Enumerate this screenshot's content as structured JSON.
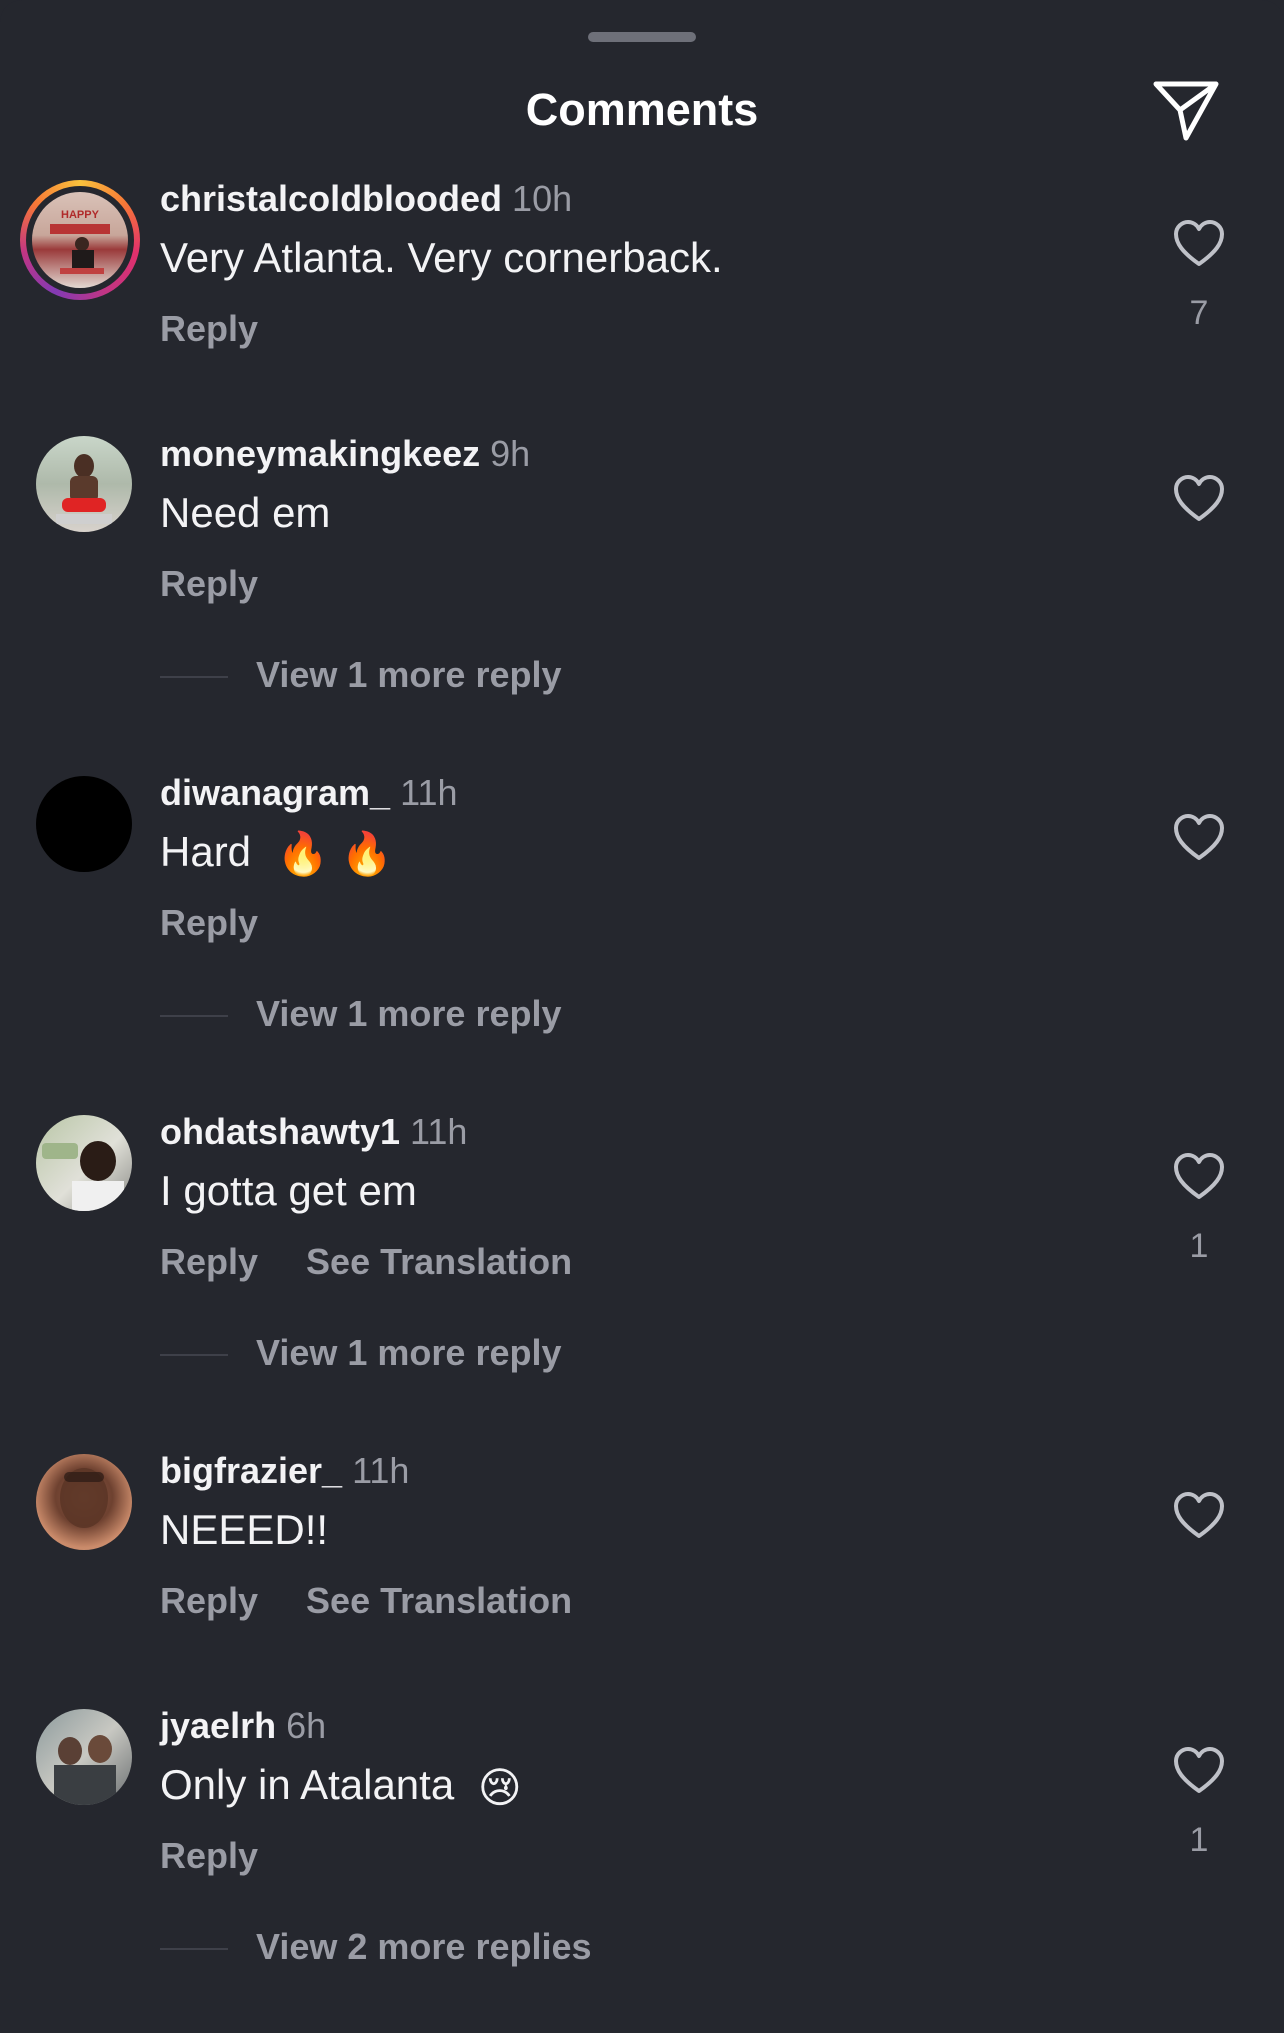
{
  "header": {
    "title": "Comments"
  },
  "icons": {
    "share": "paper-plane-icon",
    "like": "heart-outline-icon",
    "fire": "fire-emoji",
    "crying": "crying-face-emoji"
  },
  "colors": {
    "background": "#25272e",
    "primary_text": "#f3f3f5",
    "secondary_text": "#9a9ca5"
  },
  "comments": [
    {
      "username": "christalcoldblooded",
      "time": "10h",
      "text": "Very Atlanta. Very cornerback.",
      "reply_label": "Reply",
      "likes": "7",
      "has_story_ring": true,
      "avatar_label": "HAPPY"
    },
    {
      "username": "moneymakingkeez",
      "time": "9h",
      "text": "Need em",
      "reply_label": "Reply",
      "view_replies": "View 1 more reply"
    },
    {
      "username": "diwanagram_",
      "time": "11h",
      "text": "Hard",
      "text_emoji": "🔥 🔥",
      "reply_label": "Reply",
      "view_replies": "View 1 more reply"
    },
    {
      "username": "ohdatshawty1",
      "time": "11h",
      "text": "I gotta get em",
      "reply_label": "Reply",
      "translation_label": "See Translation",
      "likes": "1",
      "view_replies": "View 1 more reply"
    },
    {
      "username": "bigfrazier_",
      "time": "11h",
      "text": "NEEED!!",
      "reply_label": "Reply",
      "translation_label": "See Translation"
    },
    {
      "username": "jyaelrh",
      "time": "6h",
      "text": "Only in Atalanta",
      "text_emoji": "😢",
      "reply_label": "Reply",
      "likes": "1",
      "view_replies": "View 2 more replies"
    }
  ]
}
